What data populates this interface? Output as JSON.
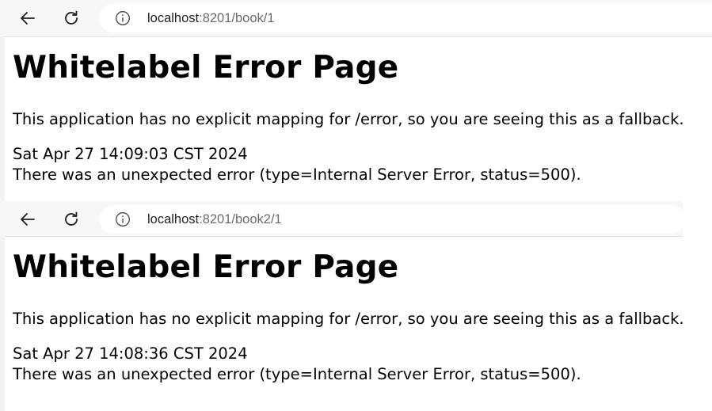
{
  "windows": [
    {
      "url_host": "localhost",
      "url_rest": ":8201/book/1",
      "heading": "Whitelabel Error Page",
      "message": "This application has no explicit mapping for /error, so you are seeing this as a fallback.",
      "timestamp": "Sat Apr 27 14:09:03 CST 2024",
      "error_detail": "There was an unexpected error (type=Internal Server Error, status=500)."
    },
    {
      "url_host": "localhost",
      "url_rest": ":8201/book2/1",
      "heading": "Whitelabel Error Page",
      "message": "This application has no explicit mapping for /error, so you are seeing this as a fallback.",
      "timestamp": "Sat Apr 27 14:08:36 CST 2024",
      "error_detail": "There was an unexpected error (type=Internal Server Error, status=500)."
    }
  ],
  "icons": {
    "back": "back-arrow-icon",
    "reload": "reload-icon",
    "site_info": "info-icon"
  },
  "colors": {
    "toolbar_bg": "#f7f7f7",
    "url_host": "#1f1f1f",
    "url_path": "#6b6b6b"
  }
}
